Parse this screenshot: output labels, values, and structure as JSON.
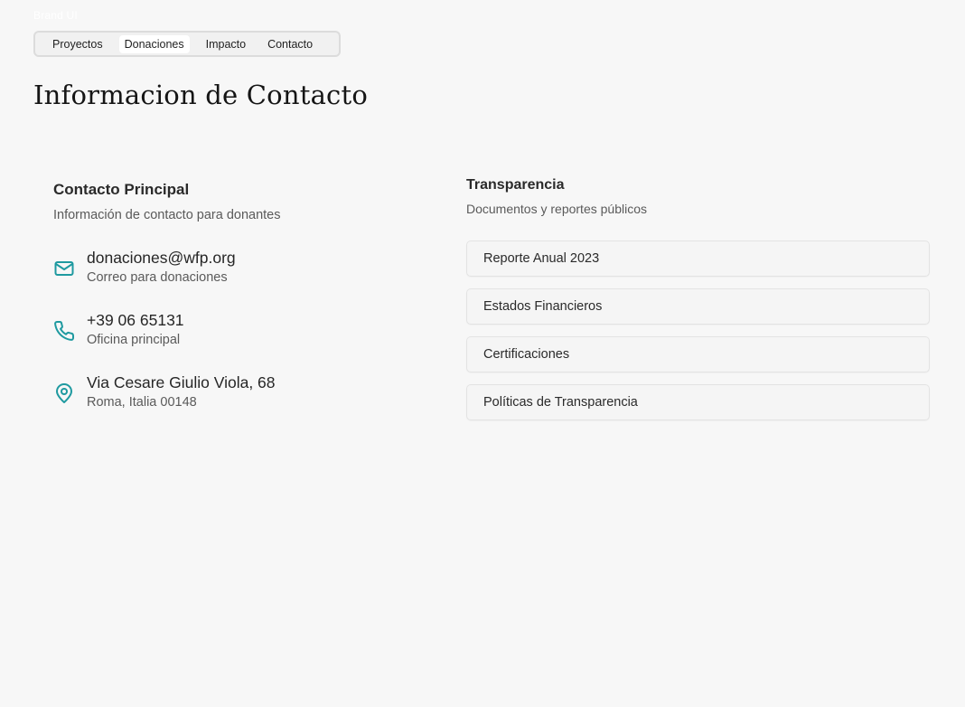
{
  "header": {
    "brand_text": "Brand UI"
  },
  "tabs": [
    {
      "label": "Proyectos",
      "active": false
    },
    {
      "label": "Donaciones",
      "active": true
    },
    {
      "label": "Impacto",
      "active": false
    },
    {
      "label": "Contacto",
      "active": false
    }
  ],
  "page": {
    "title": "Informacion de Contacto"
  },
  "contact": {
    "heading": "Contacto Principal",
    "subtitle": "Información de contacto para donantes",
    "items": [
      {
        "icon": "mail-icon",
        "primary": "donaciones@wfp.org",
        "secondary": "Correo para donaciones"
      },
      {
        "icon": "phone-icon",
        "primary": "+39 06 65131",
        "secondary": "Oficina principal"
      },
      {
        "icon": "map-pin-icon",
        "primary": "Via Cesare Giulio Viola, 68",
        "secondary": "Roma, Italia 00148"
      }
    ]
  },
  "transparency": {
    "heading": "Transparencia",
    "subtitle": "Documentos y reportes públicos",
    "documents": [
      "Reporte Anual 2023",
      "Estados Financieros",
      "Certificaciones",
      "Políticas de Transparencia"
    ]
  },
  "colors": {
    "accent_teal": "#1f9aa0",
    "background": "#f7f7f7"
  }
}
